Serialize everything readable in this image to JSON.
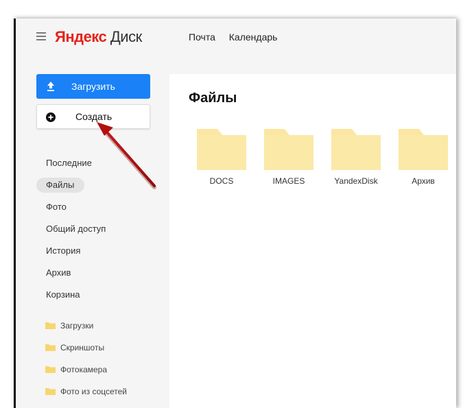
{
  "header": {
    "logo_brand": "Яндекс",
    "logo_service": "Диск",
    "nav": [
      "Почта",
      "Календарь"
    ]
  },
  "sidebar": {
    "upload_label": "Загрузить",
    "create_label": "Создать",
    "items": [
      {
        "label": "Последние",
        "active": false
      },
      {
        "label": "Файлы",
        "active": true
      },
      {
        "label": "Фото",
        "active": false
      },
      {
        "label": "Общий доступ",
        "active": false
      },
      {
        "label": "История",
        "active": false
      },
      {
        "label": "Архив",
        "active": false
      },
      {
        "label": "Корзина",
        "active": false
      }
    ],
    "folders": [
      "Загрузки",
      "Скриншоты",
      "Фотокамера",
      "Фото из соцсетей"
    ]
  },
  "main": {
    "title": "Файлы",
    "folders": [
      "DOCS",
      "IMAGES",
      "YandexDisk",
      "Архив"
    ]
  },
  "colors": {
    "accent": "#1a81f7",
    "brand_red": "#e4241b",
    "folder": "#fbe7a1",
    "arrow": "#b30f0f"
  },
  "icons": {
    "menu": "hamburger-icon",
    "upload": "upload-icon",
    "create": "plus-circle-icon",
    "folder": "folder-icon"
  }
}
